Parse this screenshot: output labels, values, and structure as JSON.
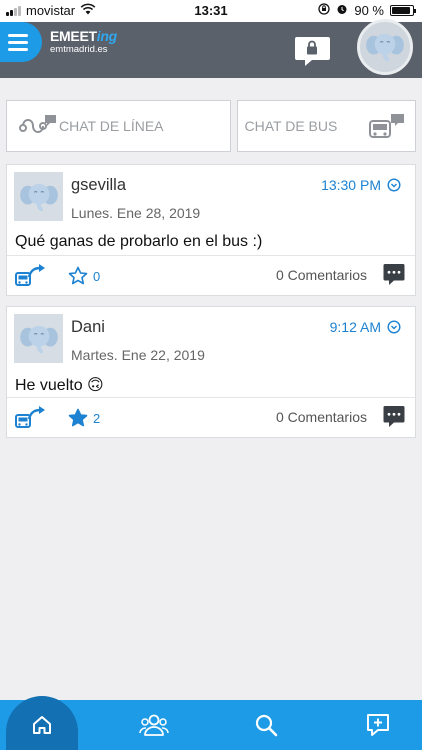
{
  "status_bar": {
    "carrier": "movistar",
    "time": "13:31",
    "battery": "90 %",
    "battery_level": 0.9
  },
  "header": {
    "logo_brand": "EMEET",
    "logo_brand_accent": "ing",
    "logo_subtitle": "emtmadrid.es",
    "icons": [
      "menu-icon",
      "lock-chat-icon",
      "elephant-avatar-icon"
    ]
  },
  "chat_tabs": {
    "line_label": "CHAT DE LÍNEA",
    "bus_label": "CHAT DE BUS"
  },
  "posts": [
    {
      "author": "gsevilla",
      "time": "13:30 PM",
      "date": "Lunes. Ene 28, 2019",
      "message": "Qué ganas de probarlo en el bus :)",
      "likes": "0",
      "liked": false,
      "comments": "0 Comentarios"
    },
    {
      "author": "Dani",
      "time": "9:12 AM",
      "date": "Martes. Ene 22, 2019",
      "message": "He vuelto 🙃",
      "likes": "2",
      "liked": true,
      "comments": "0 Comentarios"
    }
  ],
  "tab_bar": {
    "items": [
      "home-icon",
      "people-icon",
      "search-icon",
      "new-chat-icon"
    ],
    "active": "home-icon"
  },
  "colors": {
    "accent": "#1d9be6",
    "header": "#5b616b",
    "link": "#1d82d1",
    "active_tab": "#1370b3"
  }
}
